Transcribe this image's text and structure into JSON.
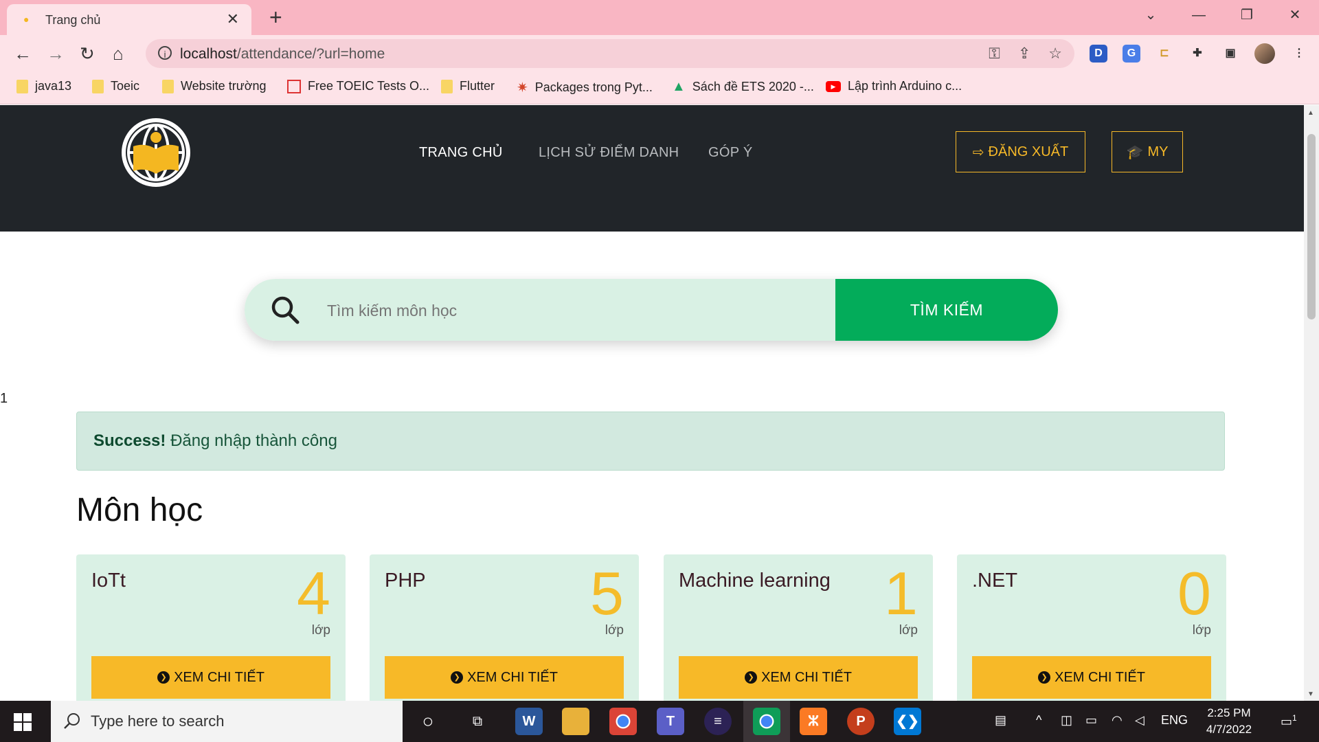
{
  "browser": {
    "tab_title": "Trang chủ",
    "url_host": "localhost",
    "url_path": "/attendance/?url=home",
    "bookmarks": [
      {
        "label": "java13",
        "icon": "folder-icon"
      },
      {
        "label": "Toeic",
        "icon": "folder-icon"
      },
      {
        "label": "Website trường",
        "icon": "folder-icon"
      },
      {
        "label": "Free TOEIC Tests O...",
        "icon": "toeic-site-icon"
      },
      {
        "label": "Flutter",
        "icon": "folder-icon"
      },
      {
        "label": "Packages trong Pyt...",
        "icon": "pinwheel-icon"
      },
      {
        "label": "Sách đề ETS 2020 -...",
        "icon": "google-drive-icon"
      },
      {
        "label": "Lập trình Arduino c...",
        "icon": "youtube-icon"
      }
    ]
  },
  "site": {
    "nav": {
      "home": "TRANG CHỦ",
      "history": "LỊCH SỬ ĐIỂM DANH",
      "feedback": "GÓP Ý"
    },
    "logout_label": "ĐĂNG XUẤT",
    "profile_label": "MY",
    "accent_color": "#f7b928",
    "header_bg": "#212529"
  },
  "search": {
    "placeholder": "Tìm kiếm môn học",
    "button_label": "TÌM KIẾM"
  },
  "stray_text": "1",
  "alert": {
    "strong": "Success!",
    "message": "Đăng nhập thành công"
  },
  "section_title": "Môn học",
  "courses": [
    {
      "name": "IoTt",
      "count": "4",
      "unit": "lớp",
      "button": "XEM CHI TIẾT"
    },
    {
      "name": "PHP",
      "count": "5",
      "unit": "lớp",
      "button": "XEM CHI TIẾT"
    },
    {
      "name": "Machine learning",
      "count": "1",
      "unit": "lớp",
      "button": "XEM CHI TIẾT"
    },
    {
      "name": ".NET",
      "count": "0",
      "unit": "lớp",
      "button": "XEM CHI TIẾT"
    }
  ],
  "taskbar": {
    "search_placeholder": "Type here to search",
    "language": "ENG",
    "time": "2:25 PM",
    "date": "4/7/2022",
    "notification_count": "1"
  }
}
